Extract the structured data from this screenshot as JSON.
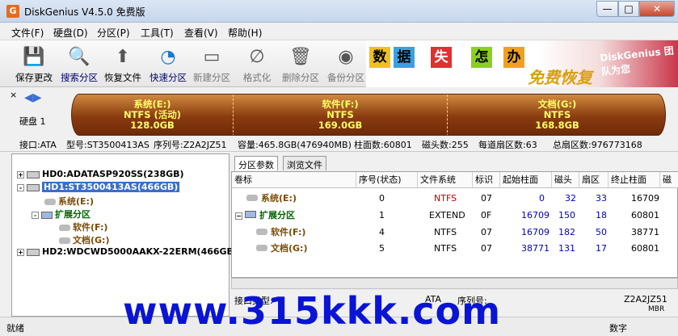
{
  "window": {
    "title": "DiskGenius V4.5.0 免费版",
    "app_icon": "G",
    "min": "—",
    "max": "□",
    "close": "✕"
  },
  "menu": [
    "文件(F)",
    "硬盘(D)",
    "分区(P)",
    "工具(T)",
    "查看(V)",
    "帮助(H)"
  ],
  "toolbar": [
    {
      "label": "保存更改",
      "icon": "save-icon",
      "glyph": "💾"
    },
    {
      "label": "搜索分区",
      "icon": "search-icon",
      "glyph": "🔍"
    },
    {
      "label": "恢复文件",
      "icon": "restore-icon",
      "glyph": "⬆"
    },
    {
      "label": "快速分区",
      "icon": "quick-partition-icon",
      "glyph": "◔"
    },
    {
      "label": "新建分区",
      "icon": "new-partition-icon",
      "glyph": "▭"
    },
    {
      "label": "格式化",
      "icon": "format-icon",
      "glyph": "∅"
    },
    {
      "label": "删除分区",
      "icon": "delete-icon",
      "glyph": "🗑"
    },
    {
      "label": "备份分区",
      "icon": "backup-icon",
      "glyph": "◉"
    }
  ],
  "banner": {
    "chars": [
      "数",
      "据",
      "失",
      "怎",
      "办"
    ],
    "slogan": "免费恢复",
    "team": "DiskGenius 团队为您"
  },
  "diskbar": {
    "close": "×",
    "label": "硬盘 1",
    "partitions": [
      {
        "name": "系统(E:)",
        "fs": "NTFS (活动)",
        "size": "128.0GB"
      },
      {
        "name": "软件(F:)",
        "fs": "NTFS",
        "size": "169.0GB"
      },
      {
        "name": "文档(G:)",
        "fs": "NTFS",
        "size": "168.8GB"
      }
    ]
  },
  "info": {
    "interface": "接口:ATA",
    "model": "型号:ST3500413AS",
    "serial": "序列号:Z2A2JZ51",
    "capacity": "容量:465.8GB(476940MB)",
    "cylinders": "柱面数:60801",
    "heads": "磁头数:255",
    "sectors_per_track": "每道扇区数:63",
    "total_sectors": "总扇区数:976773168"
  },
  "tree": [
    {
      "label": "HD0:ADATASP920SS(238GB)",
      "expander": "+"
    },
    {
      "label": "HD1:ST3500413AS(466GB)",
      "expander": "-"
    },
    {
      "label": "系统(E:)"
    },
    {
      "label": "扩展分区",
      "expander": "-"
    },
    {
      "label": "软件(F:)"
    },
    {
      "label": "文档(G:)"
    },
    {
      "label": "HD2:WDCWD5000AAKX-22ERM(466GB)",
      "expander": "+"
    }
  ],
  "tabs": [
    "分区参数",
    "浏览文件"
  ],
  "table": {
    "headers": [
      "卷标",
      "序号(状态)",
      "文件系统",
      "标识",
      "起始柱面",
      "磁头",
      "扇区",
      "终止柱面",
      "磁"
    ],
    "rows": [
      [
        "系统(E:)",
        "0",
        "NTFS",
        "07",
        "0",
        "32",
        "33",
        "16709"
      ],
      [
        "扩展分区",
        "1",
        "EXTEND",
        "0F",
        "16709",
        "150",
        "18",
        "60801"
      ],
      [
        "软件(F:)",
        "4",
        "NTFS",
        "07",
        "16709",
        "182",
        "50",
        "38771"
      ],
      [
        "文档(G:)",
        "5",
        "NTFS",
        "07",
        "38771",
        "131",
        "17",
        "60801"
      ]
    ]
  },
  "detail": {
    "iface_label": "接口类型:",
    "iface_value": "ATA",
    "serial_label": "序列号:",
    "serial_value": "Z2A2JZ51",
    "extra": "MBR"
  },
  "status": {
    "left": "就绪",
    "right": "数字"
  },
  "watermark": "www.315kkk.com",
  "colors": {
    "accent": "#3a6fc9",
    "partition": "#8a3b10",
    "watermark": "#0a14d4",
    "extend": "#006600",
    "label": "#7a4a00"
  }
}
